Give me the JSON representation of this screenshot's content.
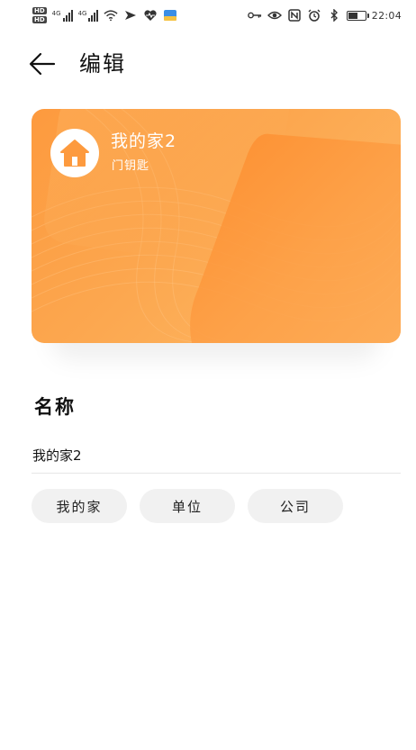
{
  "status_bar": {
    "sim1_badge": "HD",
    "sim2_badge": "HD",
    "net1_label": "4G",
    "net2_label": "4G",
    "time": "22:04",
    "battery_percent": 60
  },
  "header": {
    "title": "编辑"
  },
  "card": {
    "title": "我的家2",
    "subtitle": "门钥匙",
    "colors": {
      "base": "#fca24a",
      "accent": "#fd8f2e",
      "badge_bg": "#ffffff"
    }
  },
  "name_section": {
    "label": "名称",
    "value": "我的家2",
    "suggestions": [
      "我的家",
      "单位",
      "公司"
    ]
  },
  "colors": {
    "chip_bg": "#f1f1f1",
    "divider": "#e6e6e6"
  }
}
